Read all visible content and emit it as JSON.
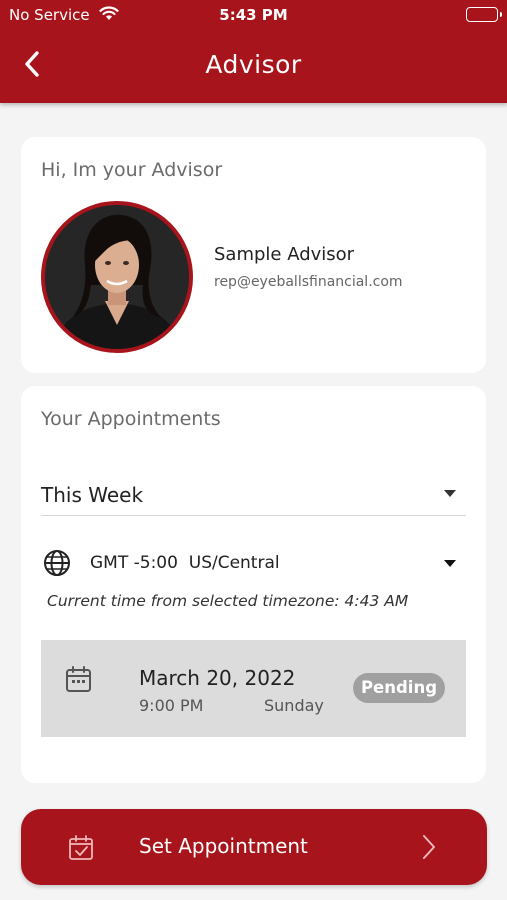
{
  "status_bar": {
    "carrier": "No Service",
    "time": "5:43 PM"
  },
  "header": {
    "title": "Advisor",
    "back_icon": "chevron-left-icon"
  },
  "advisor_card": {
    "title": "Hi, Im your Advisor",
    "name": "Sample Advisor",
    "email": "rep@eyeballsfinancial.com"
  },
  "appointments_card": {
    "title": "Your Appointments",
    "period_select": {
      "selected": "This Week"
    },
    "timezone_select": {
      "icon": "globe-icon",
      "selected": "GMT -5:00  US/Central"
    },
    "current_time_note": "Current time from selected timezone: 4:43 AM",
    "appointments": [
      {
        "date": "March 20, 2022",
        "time": "9:00 PM",
        "day": "Sunday",
        "status": "Pending",
        "icon": "calendar-icon"
      }
    ]
  },
  "set_appointment_button": {
    "label": "Set Appointment",
    "icon": "calendar-check-icon",
    "arrow_icon": "chevron-right-icon"
  },
  "colors": {
    "brand": "#a8141b",
    "page_background": "#f4f4f4",
    "appointment_row": "#dcdcdc",
    "pending_badge": "#a0a0a0"
  }
}
